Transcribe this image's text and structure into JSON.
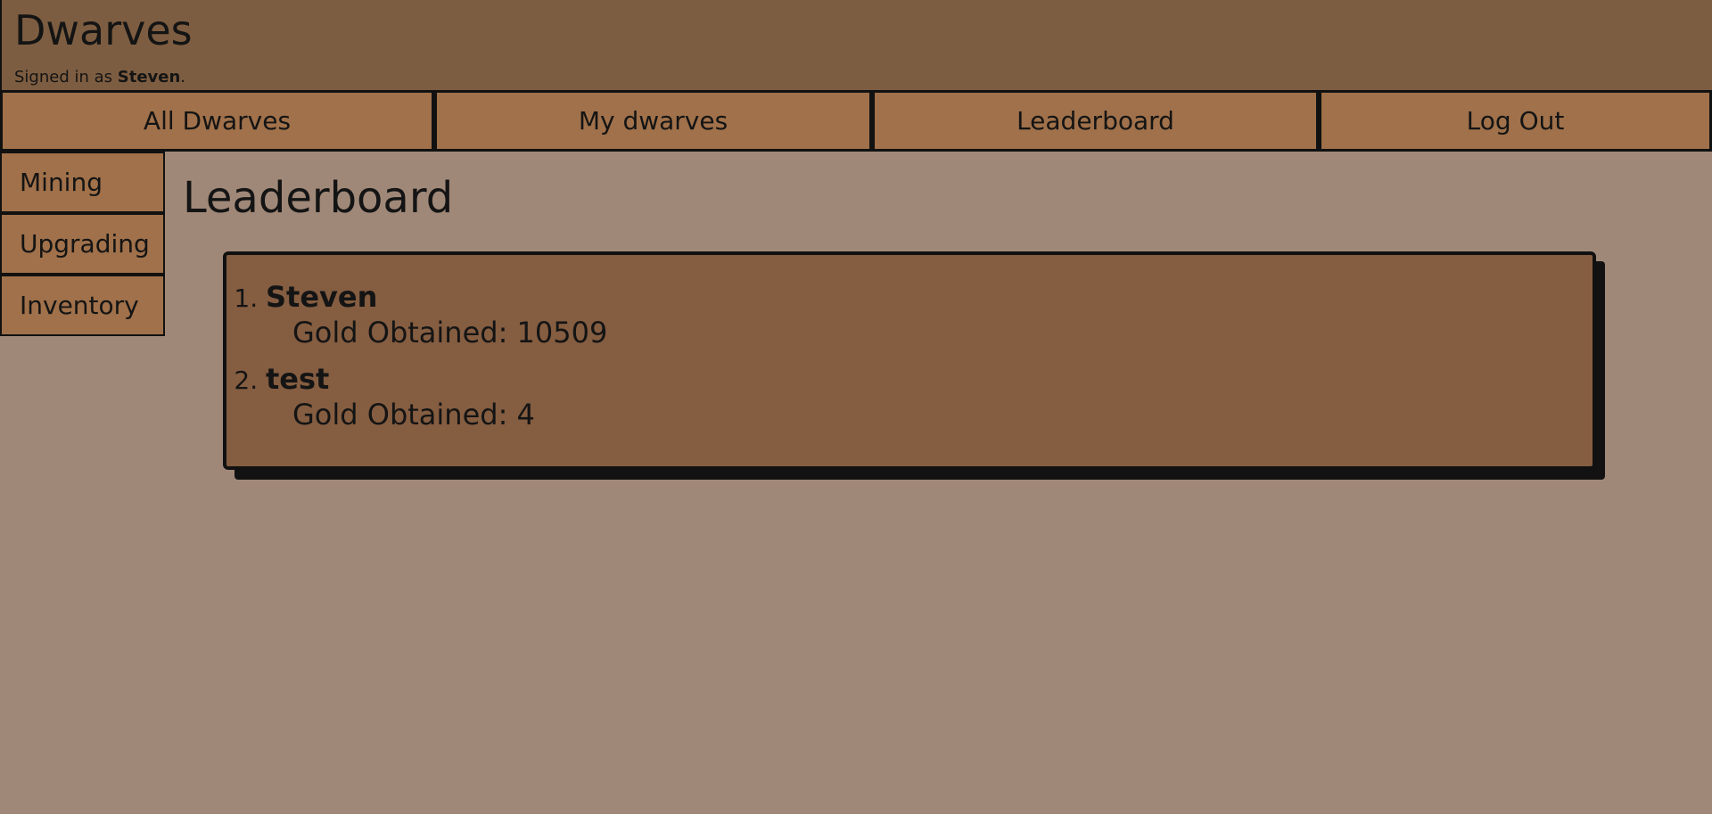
{
  "header": {
    "title": "Dwarves",
    "signed_in_prefix": "Signed in as ",
    "username": "Steven",
    "signed_in_suffix": "."
  },
  "topnav": [
    {
      "label": "All Dwarves"
    },
    {
      "label": "My dwarves"
    },
    {
      "label": "Leaderboard"
    },
    {
      "label": "Log Out"
    }
  ],
  "sidenav": [
    {
      "label": "Mining"
    },
    {
      "label": "Upgrading"
    },
    {
      "label": "Inventory"
    }
  ],
  "main": {
    "title": "Leaderboard",
    "entries": [
      {
        "name": "Steven",
        "gold_text": "Gold Obtained: 10509"
      },
      {
        "name": "test",
        "gold_text": "Gold Obtained: 4"
      }
    ]
  },
  "colors": {
    "page_bg": "#a08878",
    "header_bg": "#7d5d41",
    "nav_bg": "#a0714a",
    "board_bg": "#855d41"
  }
}
